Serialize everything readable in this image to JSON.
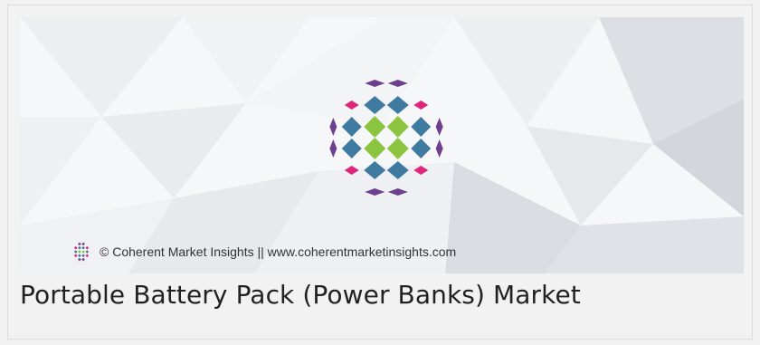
{
  "banner": {
    "copyright": "© Coherent Market Insights || www.coherentmarketinsights.com",
    "logo_icon": "coherent-market-insights-logo",
    "colors": {
      "purple": "#6e3f8d",
      "magenta": "#e0267a",
      "blue": "#3f7ba0",
      "green": "#8bc53f"
    }
  },
  "card": {
    "title": "Portable Battery Pack (Power Banks) Market"
  }
}
